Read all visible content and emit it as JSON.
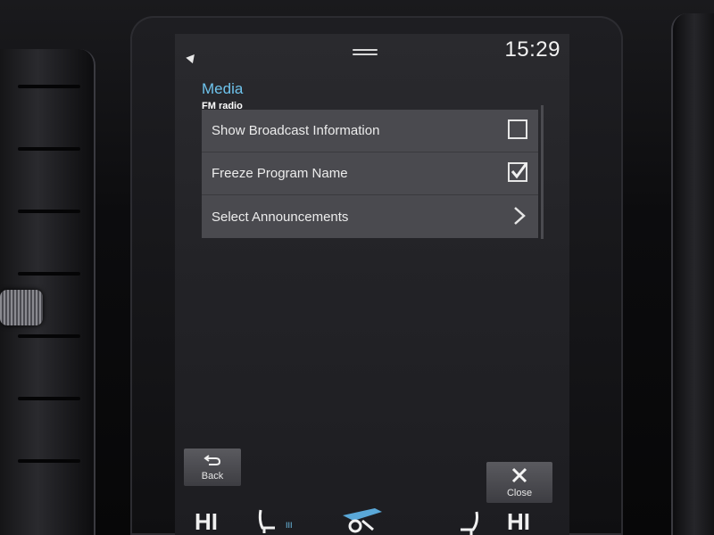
{
  "status_bar": {
    "time": "15:29",
    "location_icon": "location-arrow-icon",
    "handle_icon": "pull-down-handle-icon"
  },
  "header": {
    "title": "Media",
    "subtitle": "FM radio"
  },
  "settings": [
    {
      "label": "Show Broadcast Information",
      "control": "checkbox",
      "checked": false
    },
    {
      "label": "Freeze Program Name",
      "control": "checkbox",
      "checked": true
    },
    {
      "label": "Select Announcements",
      "control": "chevron"
    }
  ],
  "buttons": {
    "back_label": "Back",
    "close_label": "Close"
  },
  "climate": {
    "left_temp": "HI",
    "right_temp": "HI",
    "left_seat_level": "III"
  },
  "colors": {
    "accent": "#6ec3ec",
    "row_bg": "#4a4a4f",
    "screen_bg": "#232327",
    "text": "#ececec"
  }
}
